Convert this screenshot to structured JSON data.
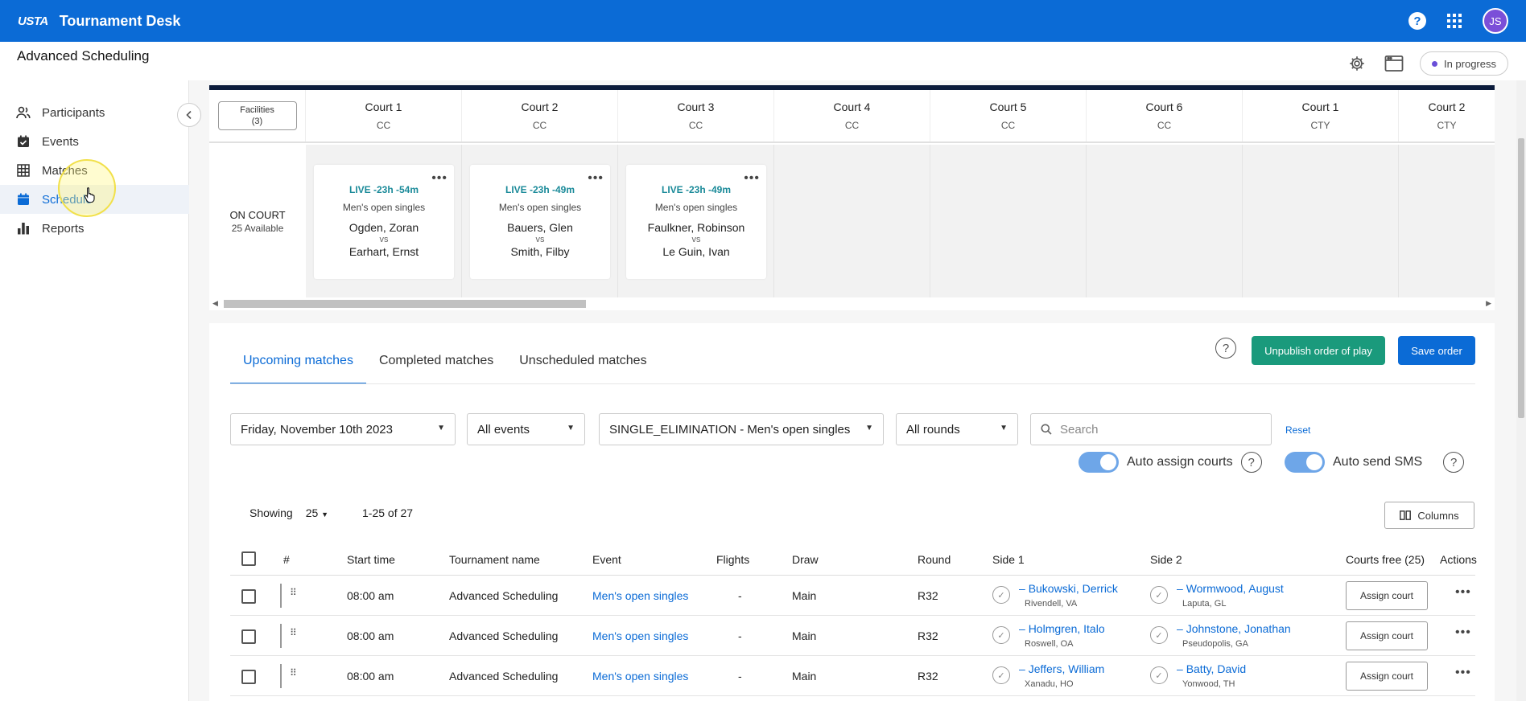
{
  "topbar": {
    "logo": "USTA",
    "title": "Tournament Desk",
    "avatar_initials": "JS"
  },
  "header": {
    "title": "Advanced Scheduling",
    "status": "In progress"
  },
  "sidebar": {
    "items": [
      {
        "label": "Participants",
        "icon": "people-icon"
      },
      {
        "label": "Events",
        "icon": "calendar-check-icon"
      },
      {
        "label": "Matches",
        "icon": "grid-icon"
      },
      {
        "label": "Schedule",
        "icon": "calendar-icon",
        "active": true
      },
      {
        "label": "Reports",
        "icon": "bar-chart-icon"
      }
    ]
  },
  "courts": {
    "facilities_label": "Facilities",
    "facilities_count": "(3)",
    "on_court_label": "ON COURT",
    "available_label": "25 Available",
    "columns": [
      {
        "name": "Court 1",
        "type": "CC"
      },
      {
        "name": "Court 2",
        "type": "CC"
      },
      {
        "name": "Court 3",
        "type": "CC"
      },
      {
        "name": "Court 4",
        "type": "CC"
      },
      {
        "name": "Court 5",
        "type": "CC"
      },
      {
        "name": "Court 6",
        "type": "CC"
      },
      {
        "name": "Court 1",
        "type": "CTY"
      },
      {
        "name": "Court 2",
        "type": "CTY"
      }
    ],
    "cards": [
      {
        "live": "LIVE -23h -54m",
        "event": "Men's open singles",
        "p1": "Ogden, Zoran",
        "vs": "vs",
        "p2": "Earhart, Ernst"
      },
      {
        "live": "LIVE -23h -49m",
        "event": "Men's open singles",
        "p1": "Bauers, Glen",
        "vs": "vs",
        "p2": "Smith, Filby"
      },
      {
        "live": "LIVE -23h -49m",
        "event": "Men's open singles",
        "p1": "Faulkner, Robinson",
        "vs": "vs",
        "p2": "Le Guin, Ivan"
      }
    ]
  },
  "tabs": [
    "Upcoming matches",
    "Completed matches",
    "Unscheduled matches"
  ],
  "buttons": {
    "unpublish": "Unpublish order of play",
    "save": "Save order",
    "reset": "Reset",
    "columns": "Columns"
  },
  "filters": {
    "date": "Friday, November 10th 2023",
    "events": "All events",
    "draw": "SINGLE_ELIMINATION - Men's open singles",
    "rounds": "All rounds",
    "search_placeholder": "Search"
  },
  "toggles": {
    "auto_assign": "Auto assign courts",
    "auto_sms": "Auto send SMS"
  },
  "paging": {
    "showing_label": "Showing",
    "page_size": "25",
    "range": "1-25 of 27"
  },
  "table": {
    "headers": {
      "num": "#",
      "start": "Start time",
      "tournament": "Tournament name",
      "event": "Event",
      "flights": "Flights",
      "draw": "Draw",
      "round": "Round",
      "side1": "Side 1",
      "side2": "Side 2",
      "courts": "Courts free (25)",
      "actions": "Actions"
    },
    "rows": [
      {
        "start": "08:00 am",
        "tournament": "Advanced Scheduling",
        "event": "Men's open singles",
        "flights": "-",
        "draw": "Main",
        "round": "R32",
        "s1_name": "Bukowski, Derrick",
        "s1_loc": "Rivendell, VA",
        "s2_name": "Wormwood, August",
        "s2_loc": "Laputa, GL",
        "action": "Assign court"
      },
      {
        "start": "08:00 am",
        "tournament": "Advanced Scheduling",
        "event": "Men's open singles",
        "flights": "-",
        "draw": "Main",
        "round": "R32",
        "s1_name": "Holmgren, Italo",
        "s1_loc": "Roswell, OA",
        "s2_name": "Johnstone, Jonathan",
        "s2_loc": "Pseudopolis, GA",
        "action": "Assign court"
      },
      {
        "start": "08:00 am",
        "tournament": "Advanced Scheduling",
        "event": "Men's open singles",
        "flights": "-",
        "draw": "Main",
        "round": "R32",
        "s1_name": "Jeffers, William",
        "s1_loc": "Xanadu, HO",
        "s2_name": "Batty, David",
        "s2_loc": "Yonwood, TH",
        "action": "Assign court"
      }
    ]
  }
}
